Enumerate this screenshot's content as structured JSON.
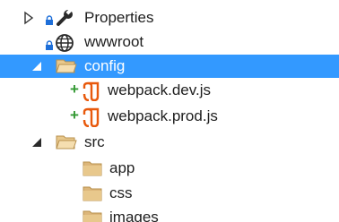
{
  "tree": {
    "items": [
      {
        "label": "Properties",
        "icon": "wrench-icon"
      },
      {
        "label": "wwwroot",
        "icon": "globe-icon"
      },
      {
        "label": "config",
        "icon": "folder-icon",
        "selected": true
      },
      {
        "label": "webpack.dev.js",
        "icon": "js-file-icon",
        "status": "+"
      },
      {
        "label": "webpack.prod.js",
        "icon": "js-file-icon",
        "status": "+"
      },
      {
        "label": "src",
        "icon": "folder-icon"
      },
      {
        "label": "app",
        "icon": "folder-icon"
      },
      {
        "label": "css",
        "icon": "folder-icon"
      },
      {
        "label": "images",
        "icon": "folder-icon"
      }
    ]
  },
  "colors": {
    "selection": "#3399ff",
    "folder": "#dcb67a",
    "js_file": "#e8590c",
    "added_status": "#339933",
    "lock": "#1e6fd9"
  }
}
